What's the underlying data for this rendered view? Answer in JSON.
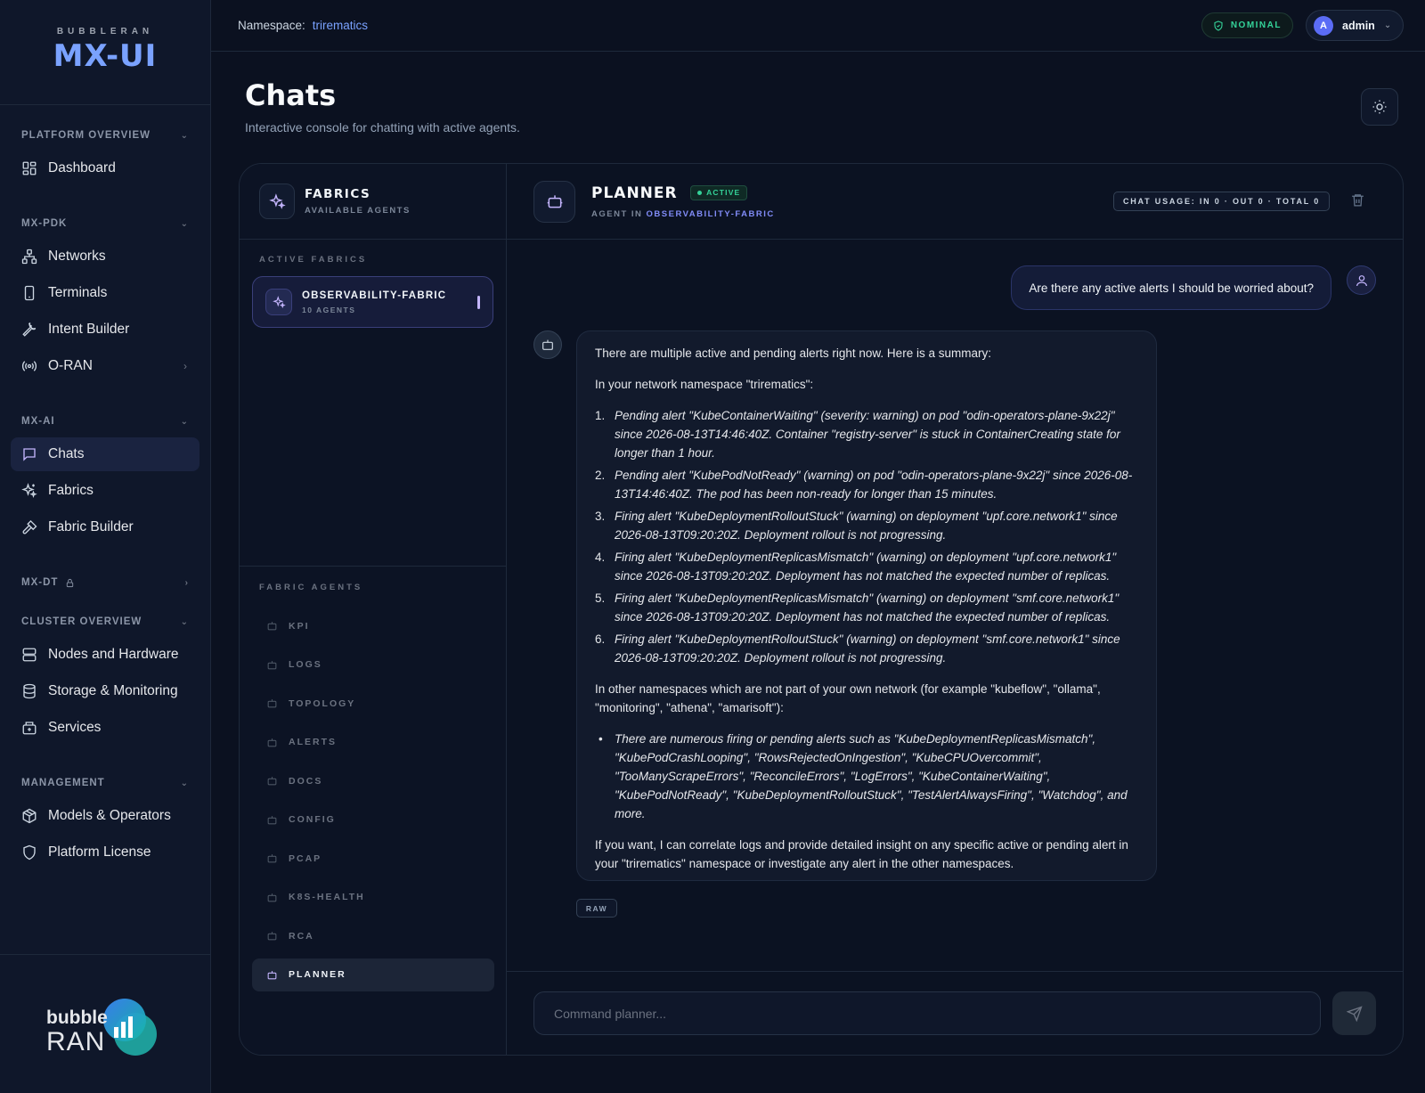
{
  "brand": {
    "small": "BUBBLERAN",
    "big": "MX-UI"
  },
  "sidebar": {
    "sections": [
      {
        "title": "PLATFORM OVERVIEW",
        "items": [
          {
            "label": "Dashboard"
          }
        ]
      },
      {
        "title": "MX-PDK",
        "items": [
          {
            "label": "Networks"
          },
          {
            "label": "Terminals"
          },
          {
            "label": "Intent Builder"
          },
          {
            "label": "O-RAN"
          }
        ]
      },
      {
        "title": "MX-AI",
        "items": [
          {
            "label": "Chats"
          },
          {
            "label": "Fabrics"
          },
          {
            "label": "Fabric Builder"
          }
        ]
      },
      {
        "title": "MX-DT",
        "items": []
      },
      {
        "title": "CLUSTER OVERVIEW",
        "items": [
          {
            "label": "Nodes and Hardware"
          },
          {
            "label": "Storage & Monitoring"
          },
          {
            "label": "Services"
          }
        ]
      },
      {
        "title": "MANAGEMENT",
        "items": [
          {
            "label": "Models & Operators"
          },
          {
            "label": "Platform License"
          }
        ]
      }
    ],
    "footer_logo": {
      "word1": "bubble",
      "word2": "RAN"
    }
  },
  "topbar": {
    "namespace_label": "Namespace:",
    "namespace_value": "trirematics",
    "status": "NOMINAL",
    "user_initial": "A",
    "user_name": "admin"
  },
  "page": {
    "title": "Chats",
    "subtitle": "Interactive console for chatting with active agents."
  },
  "fabrics": {
    "title": "FABRICS",
    "subtitle": "AVAILABLE AGENTS",
    "active_heading": "ACTIVE FABRICS",
    "active_fabric": {
      "name": "OBSERVABILITY-FABRIC",
      "count": "10 AGENTS"
    },
    "agents_heading": "FABRIC AGENTS",
    "agents": [
      "KPI",
      "LOGS",
      "TOPOLOGY",
      "ALERTS",
      "DOCS",
      "CONFIG",
      "PCAP",
      "K8S-HEALTH",
      "RCA",
      "PLANNER"
    ]
  },
  "chat": {
    "agent_name": "PLANNER",
    "status_badge": "ACTIVE",
    "agent_in_prefix": "AGENT IN",
    "agent_in_fabric": "OBSERVABILITY-FABRIC",
    "usage": "CHAT USAGE: IN 0 · OUT 0 · TOTAL 0",
    "user_message": "Are there any active alerts I should be worried about?",
    "bot": {
      "intro": "There are multiple active and pending alerts right now. Here is a summary:",
      "ns_heading": "In your network namespace \"trirematics\":",
      "items": [
        {
          "num": "1.",
          "text": "Pending alert \"KubeContainerWaiting\" (severity: warning) on pod \"odin-operators-plane-9x22j\" since 2026-08-13T14:46:40Z. Container \"registry-server\" is stuck in ContainerCreating state for longer than 1 hour."
        },
        {
          "num": "2.",
          "text": "Pending alert \"KubePodNotReady\" (warning) on pod \"odin-operators-plane-9x22j\" since 2026-08-13T14:46:40Z. The pod has been non-ready for longer than 15 minutes."
        },
        {
          "num": "3.",
          "text": "Firing alert \"KubeDeploymentRolloutStuck\" (warning) on deployment \"upf.core.network1\" since 2026-08-13T09:20:20Z. Deployment rollout is not progressing."
        },
        {
          "num": "4.",
          "text": "Firing alert \"KubeDeploymentReplicasMismatch\" (warning) on deployment \"upf.core.network1\" since 2026-08-13T09:20:20Z. Deployment has not matched the expected number of replicas."
        },
        {
          "num": "5.",
          "text": "Firing alert \"KubeDeploymentReplicasMismatch\" (warning) on deployment \"smf.core.network1\" since 2026-08-13T09:20:20Z. Deployment has not matched the expected number of replicas."
        },
        {
          "num": "6.",
          "text": "Firing alert \"KubeDeploymentRolloutStuck\" (warning) on deployment \"smf.core.network1\" since 2026-08-13T09:20:20Z. Deployment rollout is not progressing."
        }
      ],
      "other_heading": "In other namespaces which are not part of your own network (for example \"kubeflow\", \"ollama\", \"monitoring\", \"athena\", \"amarisoft\"):",
      "bullet": "There are numerous firing or pending alerts such as \"KubeDeploymentReplicasMismatch\", \"KubePodCrashLooping\", \"RowsRejectedOnIngestion\", \"KubeCPUOvercommit\", \"TooManyScrapeErrors\", \"ReconcileErrors\", \"LogErrors\", \"KubeContainerWaiting\", \"KubePodNotReady\", \"KubeDeploymentRolloutStuck\", \"TestAlertAlwaysFiring\", \"Watchdog\", and more.",
      "outro": "If you want, I can correlate logs and provide detailed insight on any specific active or pending alert in your \"trirematics\" namespace or investigate any alert in the other namespaces."
    },
    "raw_label": "RAW",
    "input_placeholder": "Command planner..."
  }
}
